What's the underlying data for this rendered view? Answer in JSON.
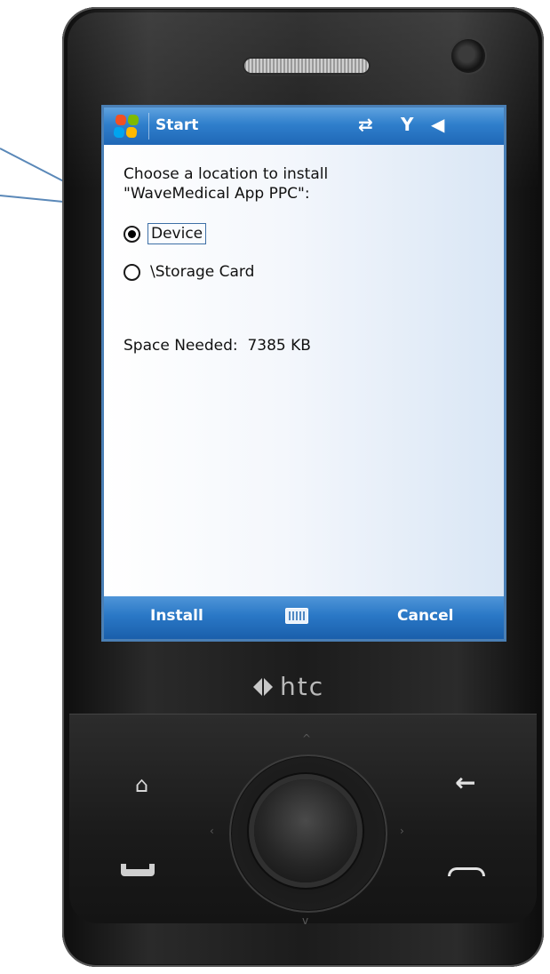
{
  "title_bar": {
    "title": "Start",
    "icons": [
      "windows-start-icon",
      "connectivity-icon",
      "signal-icon",
      "speaker-icon"
    ]
  },
  "install_dialog": {
    "prompt_line1": "Choose a location to install",
    "prompt_line2": "\"WaveMedical App PPC\":",
    "options": [
      {
        "label": "Device",
        "selected": true
      },
      {
        "label": "\\Storage Card",
        "selected": false
      }
    ],
    "space_needed_label": "Space Needed:",
    "space_needed_value": "7385 KB"
  },
  "softkeys": {
    "left": "Install",
    "center_icon": "keyboard-icon",
    "right": "Cancel"
  },
  "device": {
    "brand": "htc"
  },
  "colors": {
    "title_bar": "#2f7fcc",
    "softkey_bar": "#2a78c6",
    "screen_border": "#4a7fb5",
    "phone_body": "#1c1c1c"
  }
}
